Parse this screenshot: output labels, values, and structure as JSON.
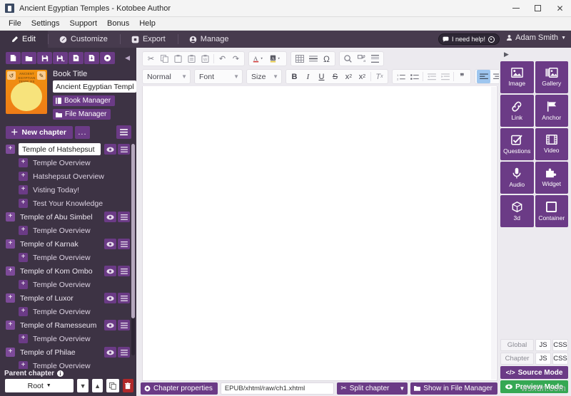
{
  "window": {
    "title": "Ancient Egyptian Temples - Kotobee Author",
    "app_icon": "book-icon",
    "minimize": "minimize-icon",
    "maximize": "maximize-icon",
    "close": "close-icon"
  },
  "menubar": {
    "items": [
      "File",
      "Settings",
      "Support",
      "Bonus",
      "Help"
    ]
  },
  "tabs": [
    {
      "label": "Edit",
      "icon": "pencil-icon",
      "active": true
    },
    {
      "label": "Customize",
      "icon": "brush-icon",
      "active": false
    },
    {
      "label": "Export",
      "icon": "export-icon",
      "active": false
    },
    {
      "label": "Manage",
      "icon": "user-circle-icon",
      "active": false
    }
  ],
  "header": {
    "help_label": "I need help!",
    "user_name": "Adam Smith"
  },
  "sidebar": {
    "file_tools": [
      "new-file-icon",
      "open-folder-icon",
      "save-icon",
      "save-as-icon",
      "export-pdf-icon",
      "import-file-icon",
      "publish-globe-icon"
    ],
    "collapse_icon": "collapse-left-icon",
    "book_title_label": "Book Title",
    "book_title_value": "Ancient Egyptian Temples",
    "cover_text": "ANCIENT EGYPTIAN TEMPLES",
    "book_manager_label": "Book Manager",
    "file_manager_label": "File Manager",
    "new_chapter_label": "New chapter",
    "more_label": "...",
    "menu_icon": "hamburger-icon",
    "tree": [
      {
        "label": "Temple of Hatshepsut",
        "level": 1,
        "editing": true,
        "actions": true
      },
      {
        "label": "Temple Overview",
        "level": 2,
        "editing": false,
        "actions": false
      },
      {
        "label": "Hatshepsut Overview",
        "level": 2,
        "editing": false,
        "actions": false
      },
      {
        "label": "Visting Today!",
        "level": 2,
        "editing": false,
        "actions": false
      },
      {
        "label": "Test Your Knowledge",
        "level": 2,
        "editing": false,
        "actions": false
      },
      {
        "label": "Temple of Abu Simbel",
        "level": 1,
        "editing": false,
        "actions": true
      },
      {
        "label": "Temple Overview",
        "level": 2,
        "editing": false,
        "actions": false
      },
      {
        "label": "Temple of Karnak",
        "level": 1,
        "editing": false,
        "actions": true
      },
      {
        "label": "Temple Overview",
        "level": 2,
        "editing": false,
        "actions": false
      },
      {
        "label": "Temple of Kom Ombo",
        "level": 1,
        "editing": false,
        "actions": true
      },
      {
        "label": "Temple Overview",
        "level": 2,
        "editing": false,
        "actions": false
      },
      {
        "label": "Temple of Luxor",
        "level": 1,
        "editing": false,
        "actions": true
      },
      {
        "label": "Temple Overview",
        "level": 2,
        "editing": false,
        "actions": false
      },
      {
        "label": "Temple of Ramesseum",
        "level": 1,
        "editing": false,
        "actions": true
      },
      {
        "label": "Temple Overview",
        "level": 2,
        "editing": false,
        "actions": false
      },
      {
        "label": "Temple of Philae",
        "level": 1,
        "editing": false,
        "actions": true
      },
      {
        "label": "Temple Overview",
        "level": 2,
        "editing": false,
        "actions": false
      }
    ],
    "parent_chapter_label": "Parent chapter",
    "parent_info_icon": "info-icon",
    "parent_value": "Root",
    "parent_buttons": [
      "move-down-icon",
      "move-up-icon",
      "duplicate-icon",
      "delete-icon"
    ]
  },
  "editor": {
    "row1_groups": [
      [
        "cut-icon",
        "copy-icon",
        "paste-icon",
        "paste-text-icon",
        "paste-word-icon",
        "undo-icon",
        "redo-icon"
      ],
      [
        "text-color-icon",
        "background-color-icon"
      ],
      [
        "table-icon",
        "horizontal-rule-icon",
        "special-char-icon"
      ],
      [
        "find-icon",
        "replace-icon",
        "page-break-icon"
      ]
    ],
    "style_select": "Normal",
    "font_select": "Font",
    "size_select": "Size",
    "format_buttons": [
      "B",
      "I",
      "U",
      "S",
      "x2sub",
      "x2sup",
      "remove-format-icon"
    ],
    "list_buttons": [
      "numbered-list-icon",
      "bulleted-list-icon",
      "decrease-indent-icon",
      "increase-indent-icon",
      "blockquote-icon"
    ],
    "align_buttons": [
      "align-left-icon",
      "align-center-icon",
      "align-right-icon",
      "align-justify-icon"
    ],
    "dir_buttons": [
      "rtl-icon",
      "ltr-icon"
    ],
    "more_icon": "toolbar-more-icon",
    "active_buttons": [
      "align-left-icon",
      "rtl-icon"
    ],
    "content": ""
  },
  "statusbar": {
    "chapter_properties_label": "Chapter properties",
    "chapter_properties_icon": "gear-icon",
    "path": "EPUB/xhtml/raw/ch1.xhtml",
    "split_chapter_label": "Split chapter",
    "split_icon": "scissors-icon",
    "show_in_file_manager_label": "Show in File Manager",
    "folder_icon": "folder-icon"
  },
  "widgets": {
    "expand_icon": "expand-right-icon",
    "items": [
      {
        "label": "Image",
        "icon": "image-icon"
      },
      {
        "label": "Gallery",
        "icon": "gallery-icon"
      },
      {
        "label": "Link",
        "icon": "link-icon"
      },
      {
        "label": "Anchor",
        "icon": "anchor-flag-icon"
      },
      {
        "label": "Questions",
        "icon": "checkbox-question-icon"
      },
      {
        "label": "Video",
        "icon": "video-icon"
      },
      {
        "label": "Audio",
        "icon": "microphone-icon"
      },
      {
        "label": "Widget",
        "icon": "widget-puzzle-icon"
      },
      {
        "label": "3d",
        "icon": "cube-icon"
      },
      {
        "label": "Container",
        "icon": "square-container-icon"
      }
    ],
    "code_rows": [
      {
        "scope": "Global",
        "js": "JS",
        "css": "CSS"
      },
      {
        "scope": "Chapter",
        "js": "JS",
        "css": "CSS"
      }
    ],
    "source_mode_label": "Source Mode",
    "source_mode_icon": "code-icon",
    "preview_mode_label": "Preview Mode",
    "preview_mode_icon": "eye-icon"
  },
  "watermark": "wsxdn.com",
  "colors": {
    "sidebar_bg": "#3d3344",
    "accent_purple": "#6b3b86",
    "tab_active_bg": "#3d3344",
    "tabstrip_bg": "#473b4e",
    "preview_green": "#35a853",
    "delete_red": "#b0282a",
    "cover_orange": "#ef8410",
    "toolbar_active": "#9ec6ef"
  }
}
